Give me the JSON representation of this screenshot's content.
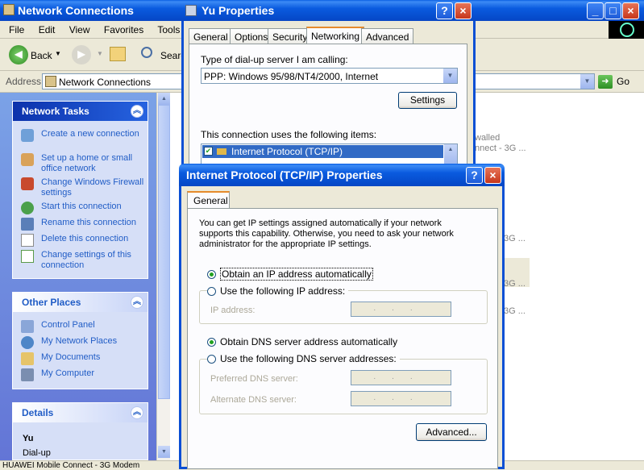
{
  "explorer": {
    "title": "Network Connections",
    "menu": [
      "File",
      "Edit",
      "View",
      "Favorites",
      "Tools",
      "A"
    ],
    "back_label": "Back",
    "search_label": "Searc",
    "address_label": "Address",
    "address_value": "Network Connections",
    "go_label": "Go",
    "right_items": [
      "walled",
      "nnect - 3G ...",
      "3G ...",
      "3G ...",
      "3G ..."
    ],
    "status_text": "HUAWEI Mobile Connect - 3G Modem"
  },
  "network_tasks": {
    "title": "Network Tasks",
    "items": [
      {
        "label": "Create a new connection",
        "icon": "new-connection-icon"
      },
      {
        "label": "Set up a home or small office network",
        "icon": "home-network-icon"
      },
      {
        "label": "Change Windows Firewall settings",
        "icon": "firewall-icon"
      },
      {
        "label": "Start this connection",
        "icon": "start-connection-icon"
      },
      {
        "label": "Rename this connection",
        "icon": "rename-icon"
      },
      {
        "label": "Delete this connection",
        "icon": "delete-icon"
      },
      {
        "label": "Change settings of this connection",
        "icon": "settings-icon"
      }
    ]
  },
  "other_places": {
    "title": "Other Places",
    "items": [
      "Control Panel",
      "My Network Places",
      "My Documents",
      "My Computer"
    ]
  },
  "details": {
    "title": "Details",
    "name": "Yu",
    "type": "Dial-up"
  },
  "yu_properties": {
    "title": "Yu Properties",
    "tabs": [
      "General",
      "Options",
      "Security",
      "Networking",
      "Advanced"
    ],
    "active_tab": "Networking",
    "server_type_label": "Type of dial-up server I am calling:",
    "server_type_value": "PPP: Windows 95/98/NT4/2000, Internet",
    "settings_button": "Settings",
    "items_label": "This connection uses the following items:",
    "items": [
      "Internet Protocol (TCP/IP)"
    ]
  },
  "tcpip": {
    "title": "Internet Protocol (TCP/IP) Properties",
    "tab": "General",
    "description": "You can get IP settings assigned automatically if your network supports this capability. Otherwise, you need to ask your network administrator for the appropriate IP settings.",
    "obtain_ip_auto": "Obtain an IP address automatically",
    "use_following_ip": "Use the following IP address:",
    "ip_address_label": "IP address:",
    "obtain_dns_auto": "Obtain DNS server address automatically",
    "use_following_dns": "Use the following DNS server addresses:",
    "preferred_dns_label": "Preferred DNS server:",
    "alternate_dns_label": "Alternate DNS server:",
    "ip_dots": "...",
    "advanced_button": "Advanced..."
  },
  "colors": {
    "titlebar": "#0A5BDF",
    "task_link": "#215DC6",
    "tab_highlight": "#E68B2C"
  }
}
